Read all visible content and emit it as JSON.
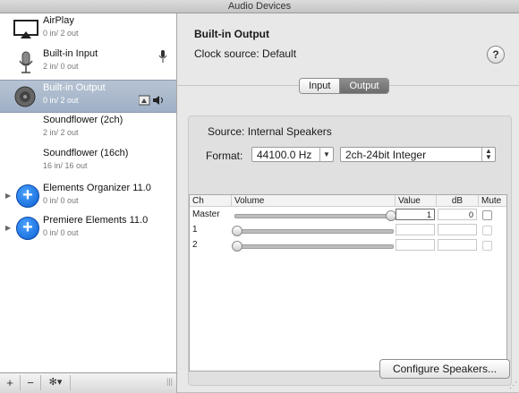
{
  "window": {
    "title": "Audio Devices"
  },
  "devices": [
    {
      "name": "AirPlay",
      "io": "0 in/ 2 out",
      "icon": "airplay-icon"
    },
    {
      "name": "Built-in Input",
      "io": "2 in/ 0 out",
      "icon": "microphone-icon"
    },
    {
      "name": "Built-in Output",
      "io": "0 in/ 2 out",
      "icon": "speaker-icon"
    },
    {
      "name": "Soundflower (2ch)",
      "io": "2 in/ 2 out"
    },
    {
      "name": "Soundflower (16ch)",
      "io": "16 in/ 16 out"
    },
    {
      "name": "Elements Organizer 11.0",
      "io": "0 in/ 0 out",
      "icon": "plus-circle-icon"
    },
    {
      "name": "Premiere Elements 11.0",
      "io": "0 in/ 0 out",
      "icon": "plus-circle-icon"
    }
  ],
  "bottombar": {
    "add": "+",
    "remove": "−",
    "gear": "✻▾"
  },
  "detail": {
    "title": "Built-in Output",
    "clock_source": "Clock source:  Default",
    "help": "?",
    "tabs": [
      "Input",
      "Output"
    ],
    "active_tab": "Output",
    "source": "Source:  Internal Speakers",
    "format_label": "Format:",
    "rate": "44100.0 Hz",
    "bits": "2ch-24bit Integer",
    "columns": [
      "Ch",
      "Volume",
      "Value",
      "dB",
      "Mute"
    ],
    "rows": [
      {
        "ch": "Master",
        "volume_fraction": 1.0,
        "value": "1",
        "db": "0"
      },
      {
        "ch": "1",
        "volume_fraction": 0.0,
        "value": "",
        "db": ""
      },
      {
        "ch": "2",
        "volume_fraction": 0.0,
        "value": "",
        "db": ""
      }
    ],
    "configure_button": "Configure Speakers..."
  },
  "colors": {
    "selection": "#a9b8cc",
    "accent": "#1e6fe0"
  }
}
